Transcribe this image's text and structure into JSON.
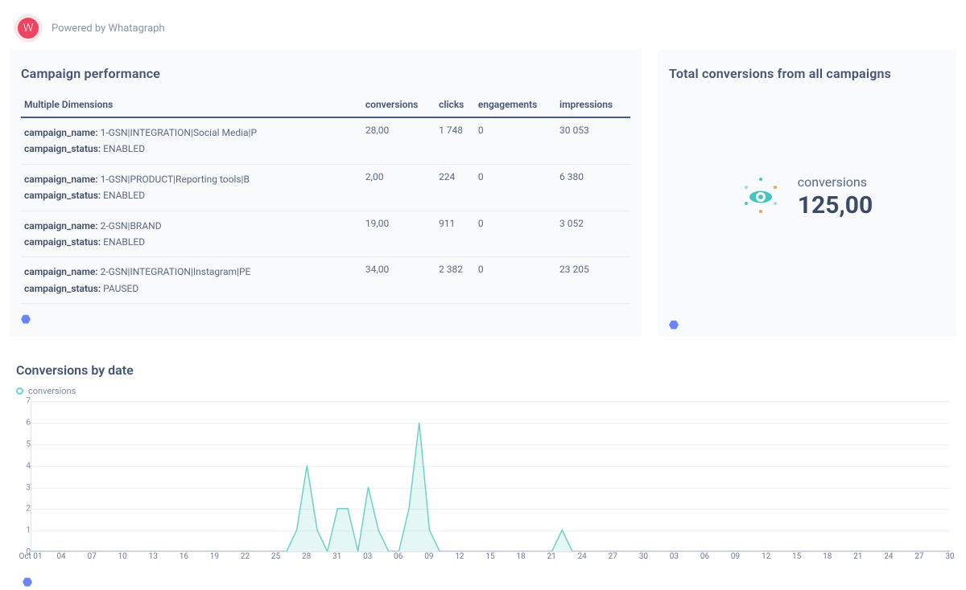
{
  "header": {
    "powered_label": "Powered by Whatagraph",
    "logo_letter": "W"
  },
  "campaign_panel": {
    "title": "Campaign performance",
    "dimension_header": "Multiple Dimensions",
    "columns": [
      "conversions",
      "clicks",
      "engagements",
      "impressions"
    ],
    "rows": [
      {
        "name_label": "campaign_name:",
        "name_value": " 1-GSN|INTEGRATION|Social Media|P",
        "status_label": "campaign_status:",
        "status_value": " ENABLED",
        "conversions": "28,00",
        "clicks": "1 748",
        "engagements": "0",
        "impressions": "30 053"
      },
      {
        "name_label": "campaign_name:",
        "name_value": " 1-GSN|PRODUCT|Reporting tools|B",
        "status_label": "campaign_status:",
        "status_value": " ENABLED",
        "conversions": "2,00",
        "clicks": "224",
        "engagements": "0",
        "impressions": "6 380"
      },
      {
        "name_label": "campaign_name:",
        "name_value": " 2-GSN|BRAND",
        "status_label": "campaign_status:",
        "status_value": " ENABLED",
        "conversions": "19,00",
        "clicks": "911",
        "engagements": "0",
        "impressions": "3 052"
      },
      {
        "name_label": "campaign_name:",
        "name_value": " 2-GSN|INTEGRATION|Instagram|PE",
        "status_label": "campaign_status:",
        "status_value": " PAUSED",
        "conversions": "34,00",
        "clicks": "2 382",
        "engagements": "0",
        "impressions": "23 205"
      }
    ]
  },
  "total_panel": {
    "title": "Total conversions from all campaigns",
    "metric_label": "conversions",
    "metric_value": "125,00"
  },
  "chart": {
    "title": "Conversions by date",
    "legend": "conversions"
  },
  "chart_data": {
    "type": "area",
    "title": "Conversions by date",
    "xlabel": "",
    "ylabel": "",
    "ylim": [
      0,
      7
    ],
    "y_ticks": [
      0,
      1,
      2,
      3,
      4,
      5,
      6,
      7
    ],
    "x_ticks": [
      "Oct 01",
      "04",
      "07",
      "10",
      "13",
      "16",
      "19",
      "22",
      "25",
      "28",
      "31",
      "03",
      "06",
      "09",
      "12",
      "15",
      "18",
      "21",
      "24",
      "27",
      "30",
      "03",
      "06",
      "09",
      "12",
      "15",
      "18",
      "21",
      "24",
      "27",
      "30"
    ],
    "series": [
      {
        "name": "conversions",
        "color": "#6cd0c9",
        "values": [
          0,
          0,
          0,
          0,
          0,
          0,
          0,
          0,
          0,
          0,
          0,
          0,
          0,
          0,
          0,
          0,
          0,
          0,
          0,
          0,
          0,
          0,
          0,
          0,
          0,
          0,
          1,
          4,
          1,
          0,
          2,
          2,
          0,
          3,
          1,
          0,
          0,
          2,
          6,
          1,
          0,
          0,
          0,
          0,
          0,
          0,
          0,
          0,
          0,
          0,
          0,
          0,
          1,
          0,
          0,
          0,
          0,
          0,
          0,
          0,
          0,
          0,
          0,
          0,
          0,
          0,
          0,
          0,
          0,
          0,
          0,
          0,
          0,
          0,
          0,
          0,
          0,
          0,
          0,
          0,
          0,
          0,
          0,
          0,
          0,
          0,
          0,
          0,
          0,
          0,
          0
        ]
      }
    ]
  }
}
